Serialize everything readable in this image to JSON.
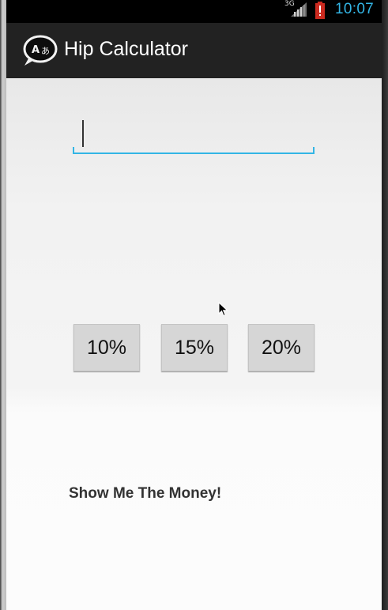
{
  "status_bar": {
    "network": "3G",
    "time": "10:07",
    "icons": [
      "signal-icon",
      "battery-alert-icon"
    ],
    "time_color": "#33b5e5"
  },
  "action_bar": {
    "title": "Hip Calculator",
    "icon": "chat-translate-icon"
  },
  "amount_input": {
    "value": "",
    "accent_color": "#33b5e5"
  },
  "tip_buttons": [
    {
      "label": "10%"
    },
    {
      "label": "15%"
    },
    {
      "label": "20%"
    }
  ],
  "result": {
    "text": "Show Me The Money!"
  }
}
